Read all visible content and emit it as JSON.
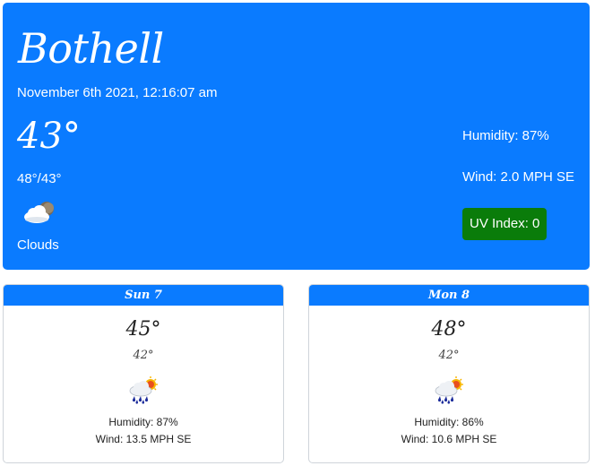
{
  "current": {
    "city": "Bothell",
    "datetime": "November 6th 2021, 12:16:07 am",
    "temp": "43°",
    "hi_lo": "48°/43°",
    "icon": "cloud-moon-icon",
    "condition": "Clouds",
    "humidity": "Humidity: 87%",
    "wind": "Wind: 2.0 MPH SE",
    "uv": "UV Index: 0",
    "uv_color": "#0a7c0a"
  },
  "forecast": [
    {
      "day": "Sun 7",
      "high": "45°",
      "low": "42°",
      "icon": "rain-sun-cloud-icon",
      "humidity": "Humidity: 87%",
      "wind": "Wind: 13.5 MPH SE"
    },
    {
      "day": "Mon 8",
      "high": "48°",
      "low": "42°",
      "icon": "rain-sun-cloud-icon",
      "humidity": "Humidity: 86%",
      "wind": "Wind: 10.6 MPH SE"
    }
  ],
  "colors": {
    "accent": "#0a7bff",
    "uv_low": "#0a7c0a"
  }
}
